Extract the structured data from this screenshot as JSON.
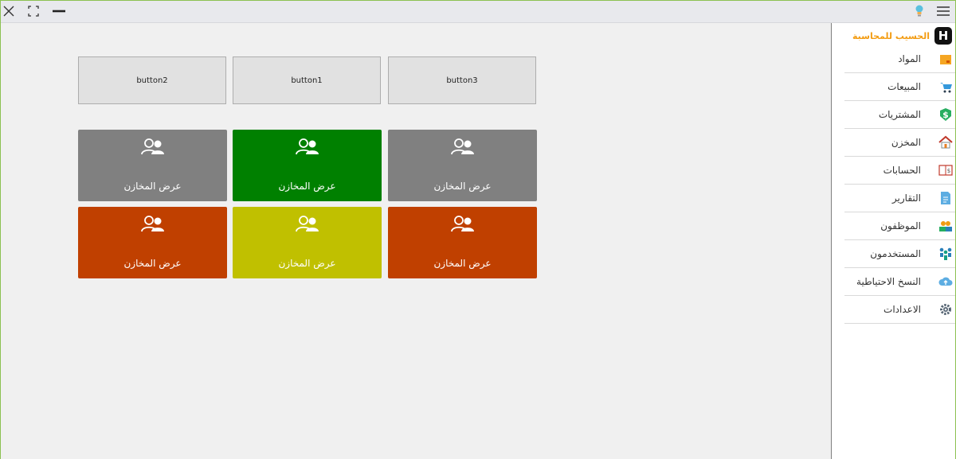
{
  "titlebar": {
    "close_icon": "close-icon",
    "fullscreen_icon": "fullscreen-icon",
    "minimize_icon": "minimize-icon",
    "bulb_icon": "lightbulb-icon",
    "menu_icon": "hamburger-menu-icon"
  },
  "buttons": {
    "button2": "button2",
    "button1": "button1",
    "button3": "button3"
  },
  "tiles": [
    {
      "label": "عرض المخازن",
      "color": "#808080",
      "icon": "users-icon"
    },
    {
      "label": "عرض المخازن",
      "color": "#008000",
      "icon": "users-icon"
    },
    {
      "label": "عرض المخازن",
      "color": "#808080",
      "icon": "users-icon"
    },
    {
      "label": "عرض المخازن",
      "color": "#c04000",
      "icon": "users-icon"
    },
    {
      "label": "عرض المخازن",
      "color": "#c0c000",
      "icon": "users-icon"
    },
    {
      "label": "عرض المخازن",
      "color": "#c04000",
      "icon": "users-icon"
    }
  ],
  "sidebar": {
    "brand": "الحسيب للمحاسبة",
    "logo_letter": "H",
    "brand_color": "#f39c12",
    "items": [
      {
        "label": "المواد",
        "icon": "box-icon"
      },
      {
        "label": "المبيعات",
        "icon": "cart-icon"
      },
      {
        "label": "المشتريات",
        "icon": "dollar-icon"
      },
      {
        "label": "المخزن",
        "icon": "house-icon"
      },
      {
        "label": "الحسابات",
        "icon": "ledger-book-icon"
      },
      {
        "label": "التقارير",
        "icon": "report-document-icon"
      },
      {
        "label": "الموظفون",
        "icon": "employees-icon"
      },
      {
        "label": "المستخدمون",
        "icon": "users-group-icon"
      },
      {
        "label": "النسخ الاحتياطية",
        "icon": "cloud-upload-icon"
      },
      {
        "label": "الاعدادات",
        "icon": "settings-gear-icon"
      }
    ]
  }
}
